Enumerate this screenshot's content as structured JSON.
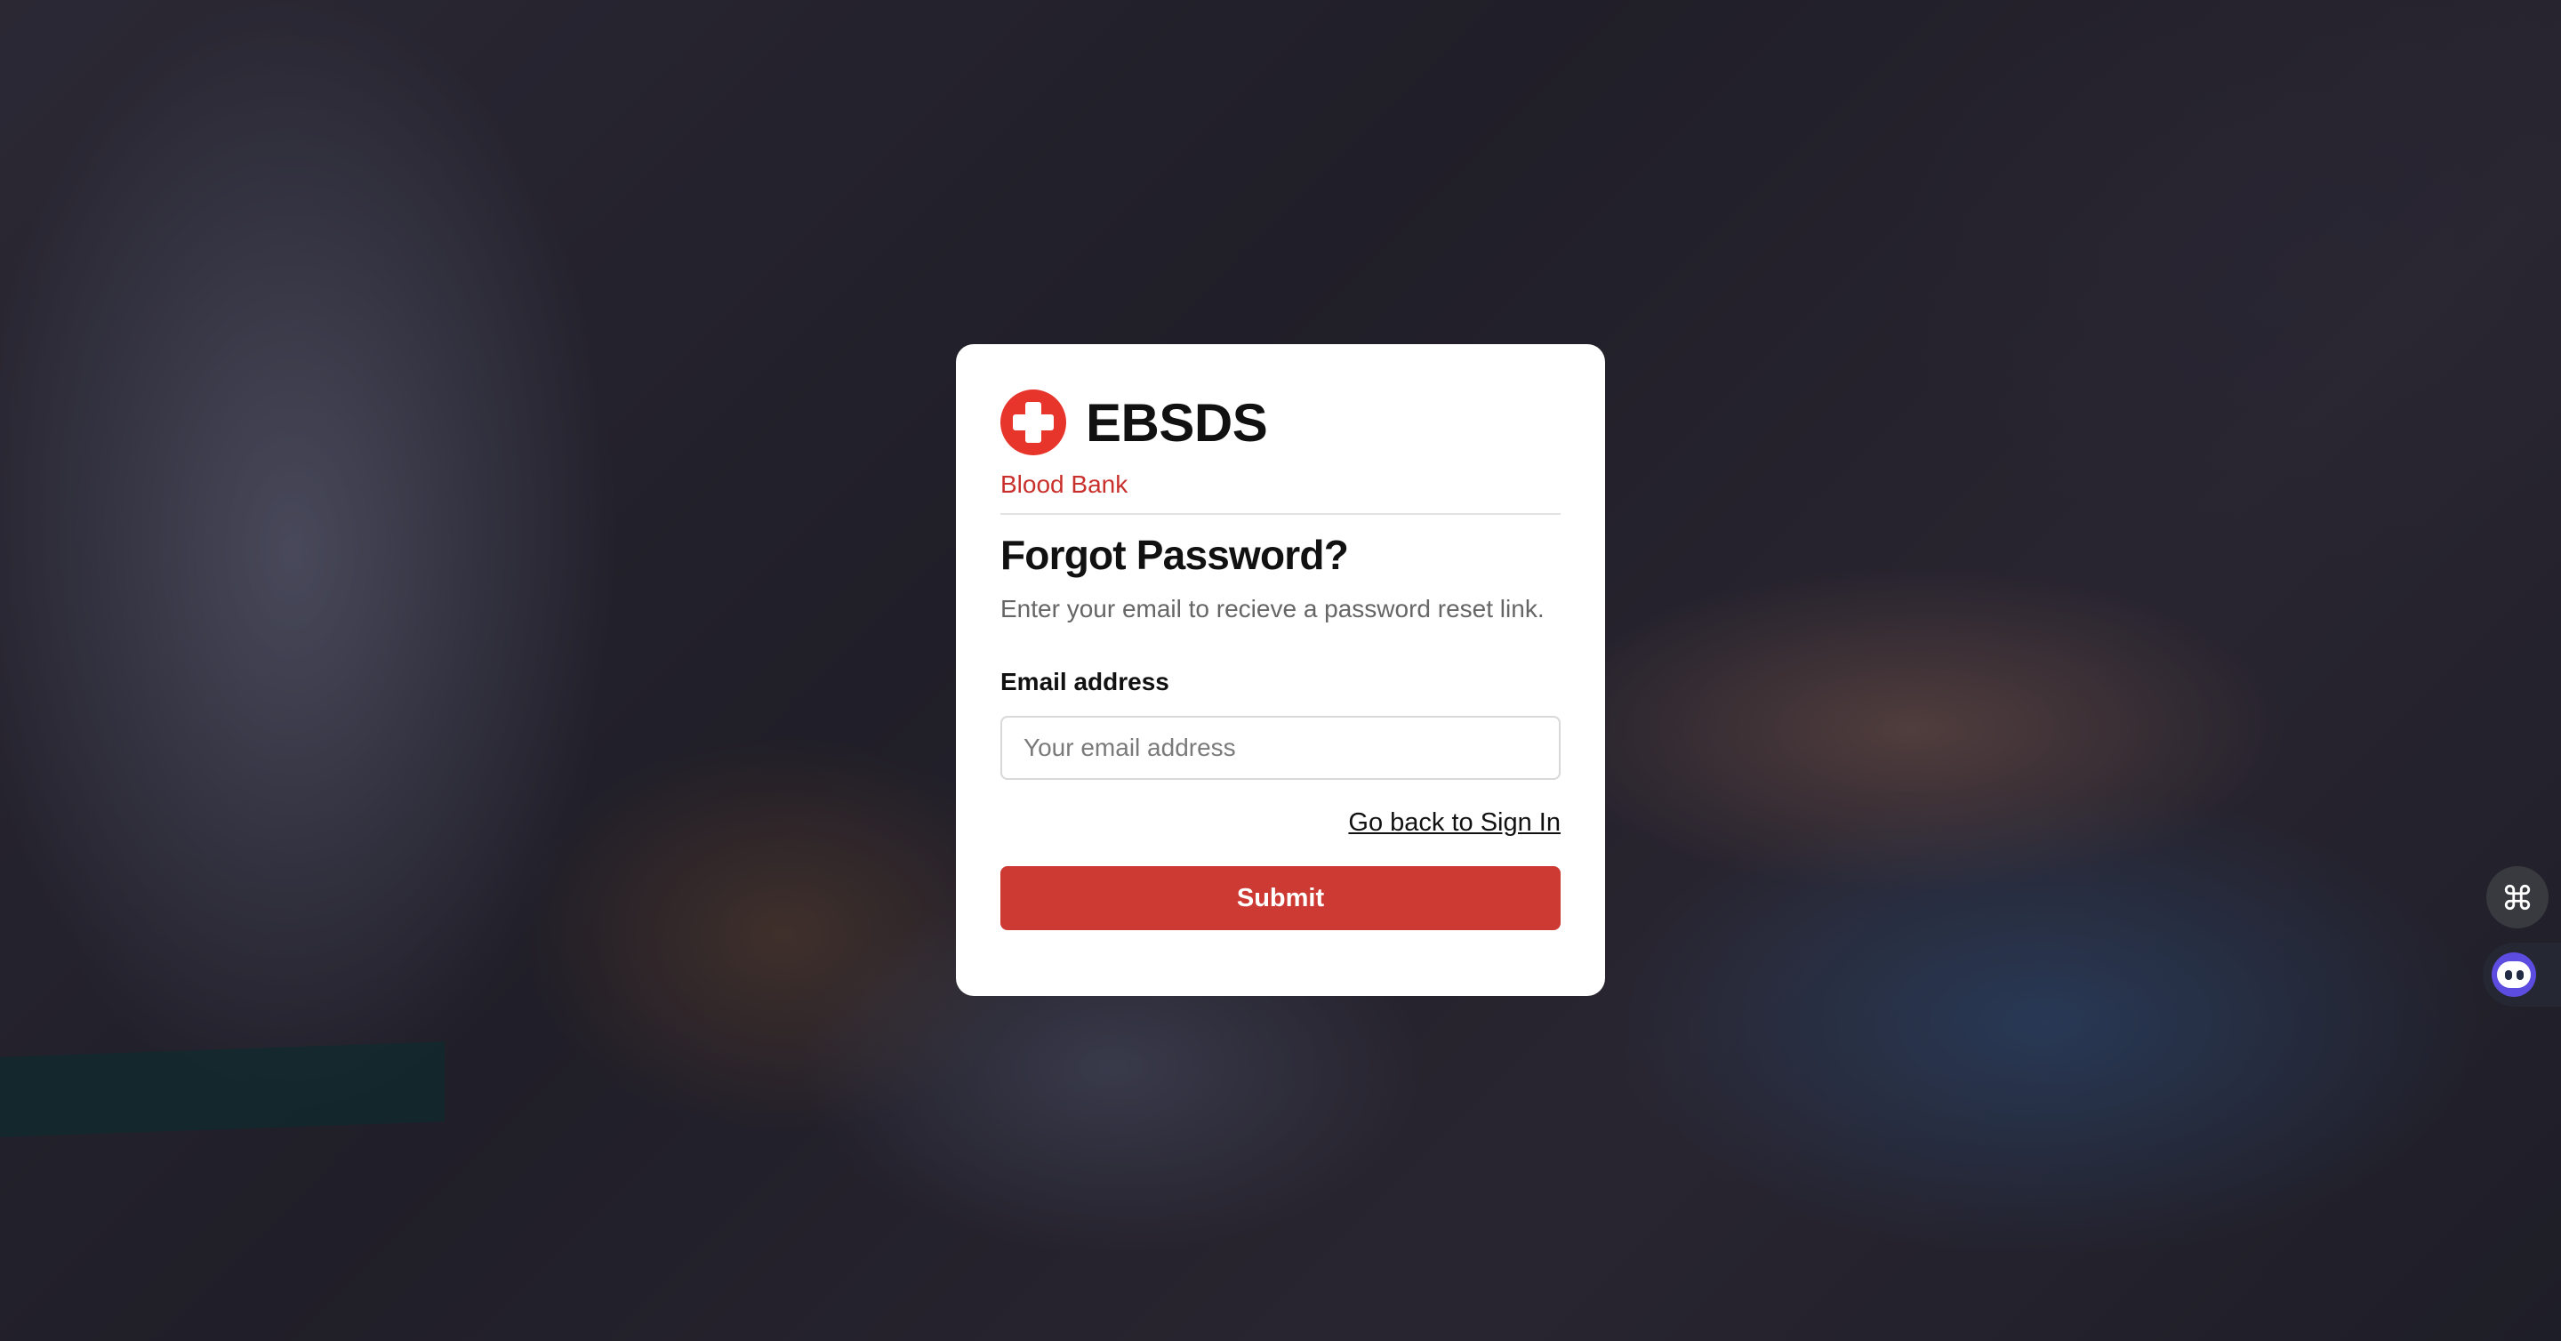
{
  "brand": {
    "name": "EBSDS",
    "subtitle": "Blood Bank",
    "accent_color": "#e8352c",
    "logo_icon": "red-cross-icon"
  },
  "form": {
    "title": "Forgot Password?",
    "description": "Enter your email to recieve a password reset link.",
    "email_label": "Email address",
    "email_placeholder": "Your email address",
    "email_value": "",
    "back_link": "Go back to Sign In",
    "submit_label": "Submit",
    "submit_color": "#cc3a33"
  },
  "floating": {
    "command_icon": "command-icon",
    "assistant_icon": "assistant-face-icon"
  }
}
